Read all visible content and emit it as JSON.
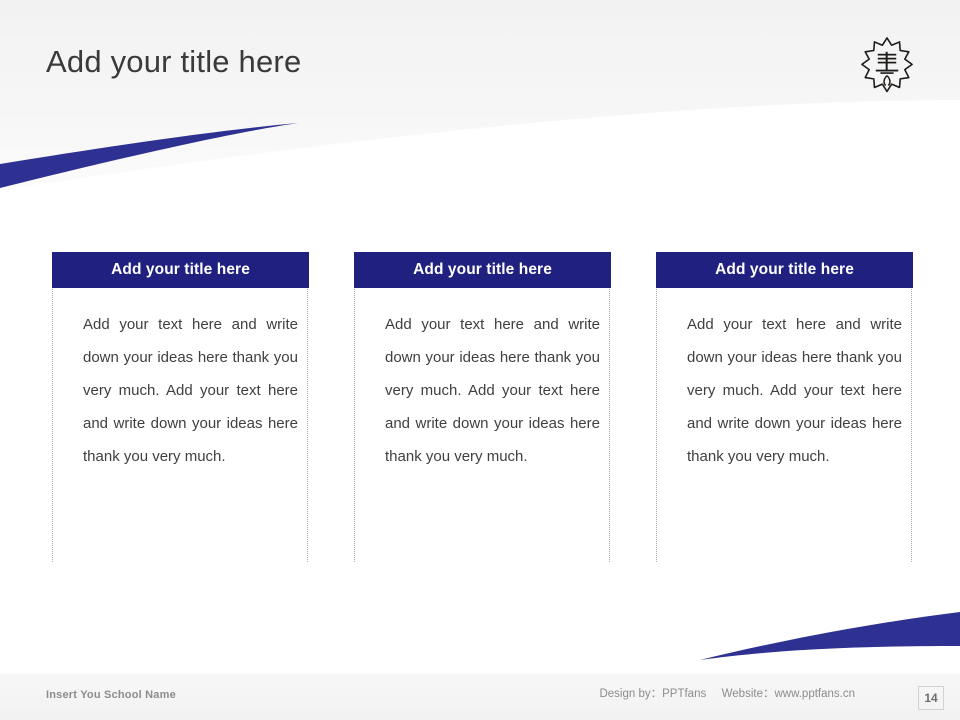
{
  "slide": {
    "title": "Add your title here",
    "logo_icon": "school-emblem-icon",
    "accent_color": "#2e3192",
    "header_bar_color": "#202080",
    "title_color": "#3a3a3a"
  },
  "cards": [
    {
      "title": "Add your title here",
      "body": "Add your text here and write down your ideas here thank you very much. Add your text here and write down your ideas here thank you very much."
    },
    {
      "title": "Add your title here",
      "body": "Add your text here and write down your ideas here thank you very much. Add your text here and write down your ideas here thank you very much."
    },
    {
      "title": "Add your title here",
      "body": "Add your text here and write down your ideas here thank you very much. Add your text here and write down your ideas here thank you very much."
    }
  ],
  "footer": {
    "school_name": "Insert You School Name",
    "design_by_label": "Design by：PPTfans",
    "website_label": "Website：www.pptfans.cn",
    "page_number": "14"
  }
}
